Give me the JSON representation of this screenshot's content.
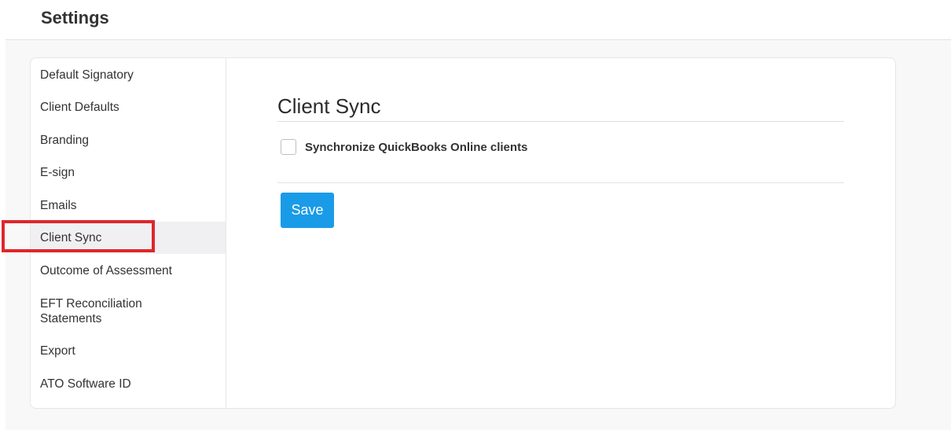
{
  "header": {
    "title": "Settings"
  },
  "sidebar": {
    "items": [
      {
        "label": "Default Signatory"
      },
      {
        "label": "Client Defaults"
      },
      {
        "label": "Branding"
      },
      {
        "label": "E-sign"
      },
      {
        "label": "Emails"
      },
      {
        "label": "Client Sync",
        "active": true
      },
      {
        "label": "Outcome of Assessment"
      },
      {
        "label": "EFT Reconciliation Statements",
        "lines": [
          "EFT Reconciliation",
          "Statements"
        ]
      },
      {
        "label": "Export"
      },
      {
        "label": "ATO Software ID"
      }
    ]
  },
  "main": {
    "section_title": "Client Sync",
    "sync_option": {
      "label": "Synchronize QuickBooks Online clients",
      "checked": false
    },
    "save_label": "Save"
  },
  "colors": {
    "accent": "#1a9be8",
    "highlight": "#e0262b",
    "active_item_bg": "#f0f0f2"
  }
}
